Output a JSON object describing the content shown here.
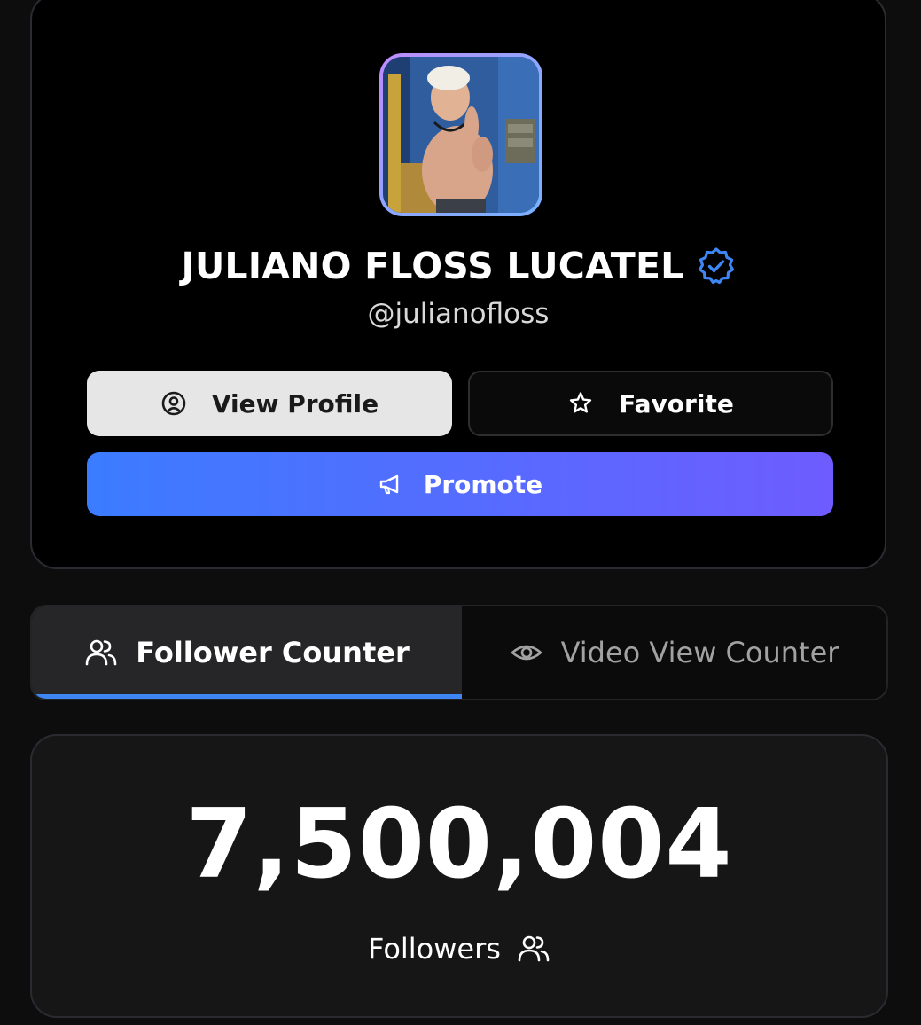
{
  "profile": {
    "name": "JULIANO FLOSS LUCATEL",
    "handle": "@julianofloss",
    "verified": true
  },
  "buttons": {
    "view_profile": "View Profile",
    "favorite": "Favorite",
    "promote": "Promote"
  },
  "tabs": [
    {
      "label": "Follower Counter",
      "icon": "users-icon",
      "active": true
    },
    {
      "label": "Video View Counter",
      "icon": "eye-icon",
      "active": false
    }
  ],
  "counter": {
    "value": "7,500,004",
    "label": "Followers",
    "icon": "users-icon"
  },
  "colors": {
    "accent": "#3f86f5",
    "promote_gradient_start": "#3b7cff",
    "promote_gradient_end": "#6e5cff",
    "verified_badge": "#3f86f5"
  }
}
